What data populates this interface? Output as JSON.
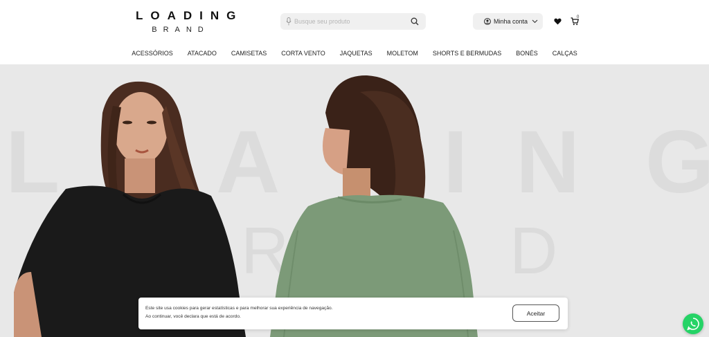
{
  "brand": {
    "line1": "LOADING",
    "line2": "BRAND"
  },
  "search": {
    "placeholder": "Busque seu produto",
    "value": ""
  },
  "account": {
    "label": "Minha conta"
  },
  "cart": {
    "count": "0"
  },
  "nav": {
    "items": [
      "ACESSÓRIOS",
      "ATACADO",
      "CAMISETAS",
      "CORTA VENTO",
      "JAQUETAS",
      "MOLETOM",
      "SHORTS E BERMUDAS",
      "BONÉS",
      "CALÇAS"
    ]
  },
  "hero": {
    "bg_word_top": [
      "L",
      "A",
      "I",
      "N",
      "G"
    ],
    "bg_word_bottom": [
      "R",
      "D"
    ]
  },
  "cookie": {
    "line1": "Este site usa cookies para gerar estatísticas e para melhorar sua experiência de navegação.",
    "line2": "Ao continuar, você declara que está de acordo.",
    "accept_label": "Aceitar"
  },
  "colors": {
    "hero_bg": "#e8e8e8",
    "whatsapp": "#25d366",
    "black_shirt": "#1a1a1a",
    "green_shirt": "#7c9a78"
  },
  "icons": [
    "mic-icon",
    "search-icon",
    "user-icon",
    "chevron-down-icon",
    "heart-icon",
    "cart-icon",
    "whatsapp-icon"
  ]
}
